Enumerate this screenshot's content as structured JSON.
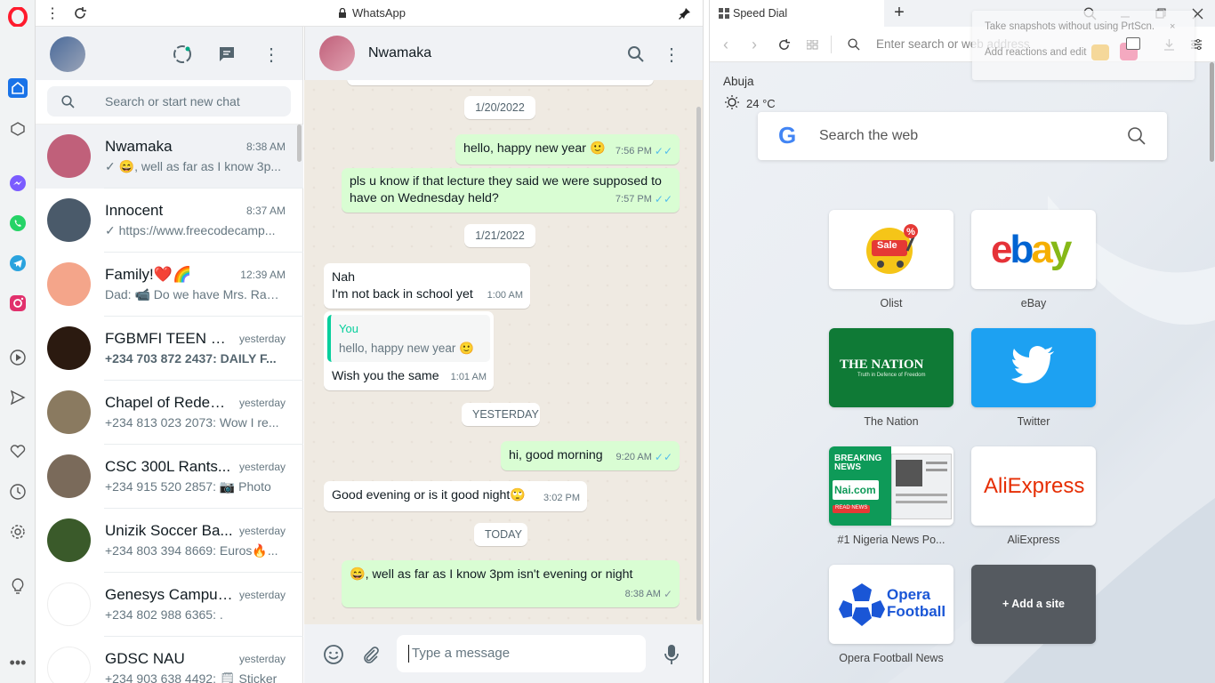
{
  "opera": {
    "sidebar_icons": [
      "opera-logo-icon",
      "home-icon",
      "cube-icon",
      "messenger-icon",
      "whatsapp-icon",
      "telegram-icon",
      "instagram-icon",
      "player-icon",
      "send-icon",
      "heart-icon",
      "history-icon",
      "settings-icon",
      "lightbulb-icon",
      "more-icon"
    ]
  },
  "wa_window": {
    "title": "WhatsApp"
  },
  "left": {
    "search_placeholder": "Search or start new chat",
    "chats": [
      {
        "name": "Nwamaka",
        "time": "8:38 AM",
        "prefix": "✓ 😄",
        "last": ", well as far as I know 3p...",
        "avatar": "#c0607a"
      },
      {
        "name": "Innocent",
        "time": "8:37 AM",
        "prefix": "✓",
        "last": " https://www.freecodecamp...",
        "avatar": "#4a5a6a"
      },
      {
        "name": "Family!❤️🌈",
        "time": "12:39 AM",
        "prefix": "Dad: 📹",
        "last": " Do we have Mrs. Ras...",
        "avatar": "#f4a58a"
      },
      {
        "name": "FGBMFI TEEN GR...",
        "time": "yesterday",
        "prefix": "+234 703 872 2437:",
        "last": " DAILY F...",
        "avatar": "#2b1a10",
        "bold": true
      },
      {
        "name": "Chapel of Redem...",
        "time": "yesterday",
        "prefix": "+234 813 023 2073:",
        "last": " Wow I re...",
        "avatar": "#8a7a60"
      },
      {
        "name": "CSC 300L Rants...",
        "time": "yesterday",
        "prefix": "+234 915 520 2857:",
        "last": " 📷 Photo",
        "avatar": "#7a6a5a"
      },
      {
        "name": "Unizik Soccer Ba...",
        "time": "yesterday",
        "prefix": "+234 803 394 8669:",
        "last": " Euros🔥...",
        "avatar": "#3a5a2a"
      },
      {
        "name": "Genesys Campus ...",
        "time": "yesterday",
        "prefix": "+234 802 988 6365:",
        "last": " .",
        "avatar": "#ffffff"
      },
      {
        "name": "GDSC NAU",
        "time": "yesterday",
        "prefix": "+234 903 638 4492:",
        "last": " 🗒 Sticker",
        "avatar": "#ffffff"
      }
    ]
  },
  "conversation": {
    "contact": "Nwamaka",
    "date1": "1/20/2022",
    "m1": {
      "text": "hello, happy new year 🙂",
      "time": "7:56 PM"
    },
    "m2": {
      "text": "pls u know if that lecture they said we were supposed to have on Wednesday held?",
      "time": "7:57 PM"
    },
    "date2": "1/21/2022",
    "m3": {
      "line1": "Nah",
      "line2": "I'm not back in school yet",
      "time": "1:00 AM"
    },
    "m4": {
      "quote_author": "You",
      "quote_text": "hello, happy new year 🙂",
      "text": "Wish you the same",
      "time": "1:01 AM"
    },
    "date3": "YESTERDAY",
    "m5": {
      "text": "hi, good morning",
      "time": "9:20 AM"
    },
    "m6": {
      "text": "Good evening or is it good night🙄",
      "time": "3:02 PM"
    },
    "date4": "TODAY",
    "m7": {
      "text": "😄, well as far as I know 3pm isn't evening or night",
      "time": "8:38 AM"
    },
    "input_placeholder": "Type a message"
  },
  "speeddial": {
    "tab_title": "Speed Dial",
    "address_placeholder": "Enter search or web address",
    "snapshot_tip1": "Take snapshots without using PrtScn.",
    "snapshot_tip2": "Add reactions and edit",
    "weather_city": "Abuja",
    "weather_temp": "24 °C",
    "search_placeholder": "Search the web",
    "tiles": [
      {
        "label": "Olist"
      },
      {
        "label": "eBay"
      },
      {
        "label": "The Nation",
        "text": "THE NATION",
        "subtext": "Truth in Defence of Freedom"
      },
      {
        "label": "Twitter"
      },
      {
        "label": "#1 Nigeria News Po...",
        "text1": "BREAKING",
        "text2": "NEWS",
        "text3": "Nai.com",
        "text4": "READ NEWS"
      },
      {
        "label": "AliExpress",
        "text": "AliExpress"
      },
      {
        "label": "Opera Football News",
        "text1": "Opera",
        "text2": "Football"
      },
      {
        "label": "",
        "text": "+ Add a site"
      }
    ],
    "olist_sale": "Sale",
    "ebay_letters": [
      "e",
      "b",
      "a",
      "y"
    ]
  },
  "colors": {
    "wa_green": "#d9fdd3",
    "wa_panel": "#f0f2f5",
    "opera_red": "#ff1b2d",
    "teal": "#00a884"
  }
}
